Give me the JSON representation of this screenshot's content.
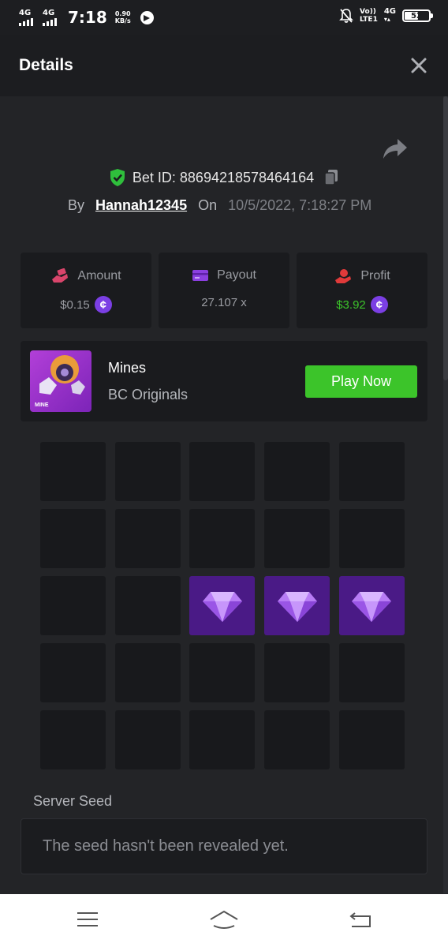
{
  "status_bar": {
    "signal1": "4G",
    "signal2": "4G",
    "time": "7:18",
    "speed_value": "0.90",
    "speed_unit": "KB/s",
    "volte_top": "Vo))",
    "volte_bottom": "LTE1",
    "network": "4G",
    "battery": "52"
  },
  "header": {
    "title": "Details",
    "close_icon": "close-icon"
  },
  "bet": {
    "id_label": "Bet ID: 88694218578464164",
    "by_label": "By",
    "username": "Hannah12345",
    "on_label": "On",
    "date": "10/5/2022, 7:18:27 PM"
  },
  "stats": [
    {
      "label": "Amount",
      "value": "$0.15",
      "icon": "money-hand-icon",
      "color": "#d9456b",
      "value_color": "#9a9ca2",
      "has_coin": true
    },
    {
      "label": "Payout",
      "value": "27.107 x",
      "icon": "card-icon",
      "color": "#8b3fe0",
      "value_color": "#9a9ca2",
      "has_coin": false
    },
    {
      "label": "Profit",
      "value": "$3.92",
      "icon": "profit-hand-icon",
      "color": "#e03a3a",
      "value_color": "#3cc42a",
      "has_coin": true
    }
  ],
  "game": {
    "name": "Mines",
    "provider": "BC Originals",
    "thumb_text": "MINE",
    "play_label": "Play Now"
  },
  "grid": {
    "rows": 5,
    "cols": 5,
    "gems": [
      [
        2,
        2
      ],
      [
        2,
        3
      ],
      [
        2,
        4
      ]
    ]
  },
  "server_seed": {
    "label": "Server Seed",
    "value": "The seed hasn't been revealed yet."
  },
  "colors": {
    "accent_green": "#3cc42a",
    "gem_purple": "#4a1a86",
    "coin_purple": "#7b3fe4",
    "background": "#232427"
  }
}
